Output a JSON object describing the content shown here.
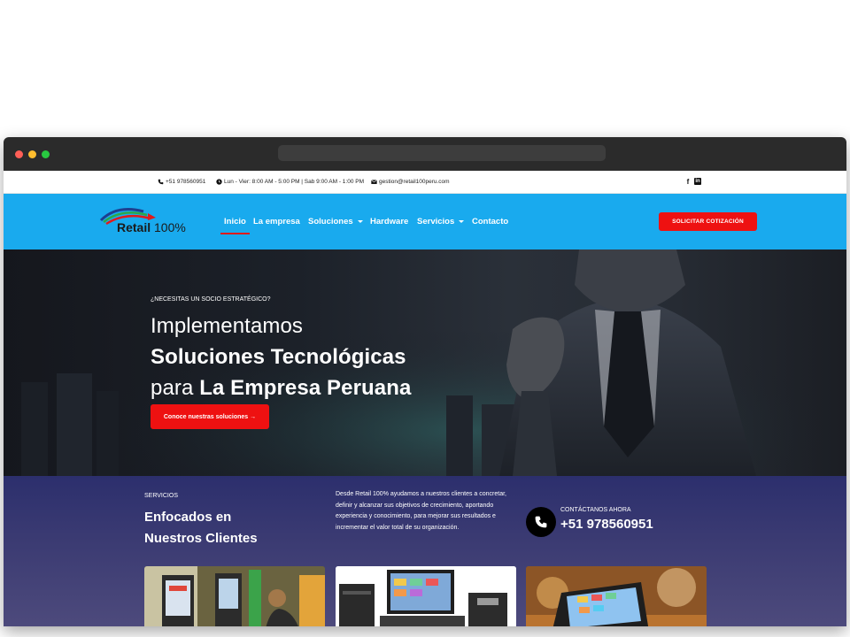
{
  "topbar": {
    "phone": "+51 978560951",
    "hours": "Lun - Vier: 8:00 AM - 5:00 PM | Sab 9:00 AM - 1:00 PM",
    "email": "gestion@retail100peru.com",
    "social": [
      "f",
      "in"
    ]
  },
  "nav": {
    "logo_word": "Retail",
    "logo_pct": "100%",
    "items": [
      {
        "label": "Inicio",
        "dropdown": false,
        "active": true
      },
      {
        "label": "La empresa",
        "dropdown": false
      },
      {
        "label": "Soluciones",
        "dropdown": true
      },
      {
        "label": "Hardware",
        "dropdown": false
      },
      {
        "label": "Servicios",
        "dropdown": true
      },
      {
        "label": "Contacto",
        "dropdown": false
      }
    ],
    "cta": "SOLICITAR COTIZACIÓN"
  },
  "hero": {
    "eyebrow": "¿NECESITAS UN SOCIO ESTRATÉGICO?",
    "line1": "Implementamos",
    "line2": "Soluciones Tecnológicas",
    "line3_regular": "para ",
    "line3_bold": "La Empresa Peruana",
    "button": "Conoce nuestras soluciones →"
  },
  "services": {
    "eyebrow": "SERVICIOS",
    "title_line1": "Enfocados en",
    "title_line2": "Nuestros Clientes",
    "description": "Desde Retail 100% ayudamos a nuestros clientes a concretar, definir y alcanzar sus objetivos de crecimiento, aportando experiencia y conocimiento, para mejorar sus resultados e incrementar el valor total de su organización.",
    "contact_label": "CONTÁCTANOS AHORA",
    "contact_phone": "+51 978560951"
  },
  "colors": {
    "nav_bg": "#19aaee",
    "accent_red": "#ee1111",
    "services_bg": "#2c2f6d"
  }
}
